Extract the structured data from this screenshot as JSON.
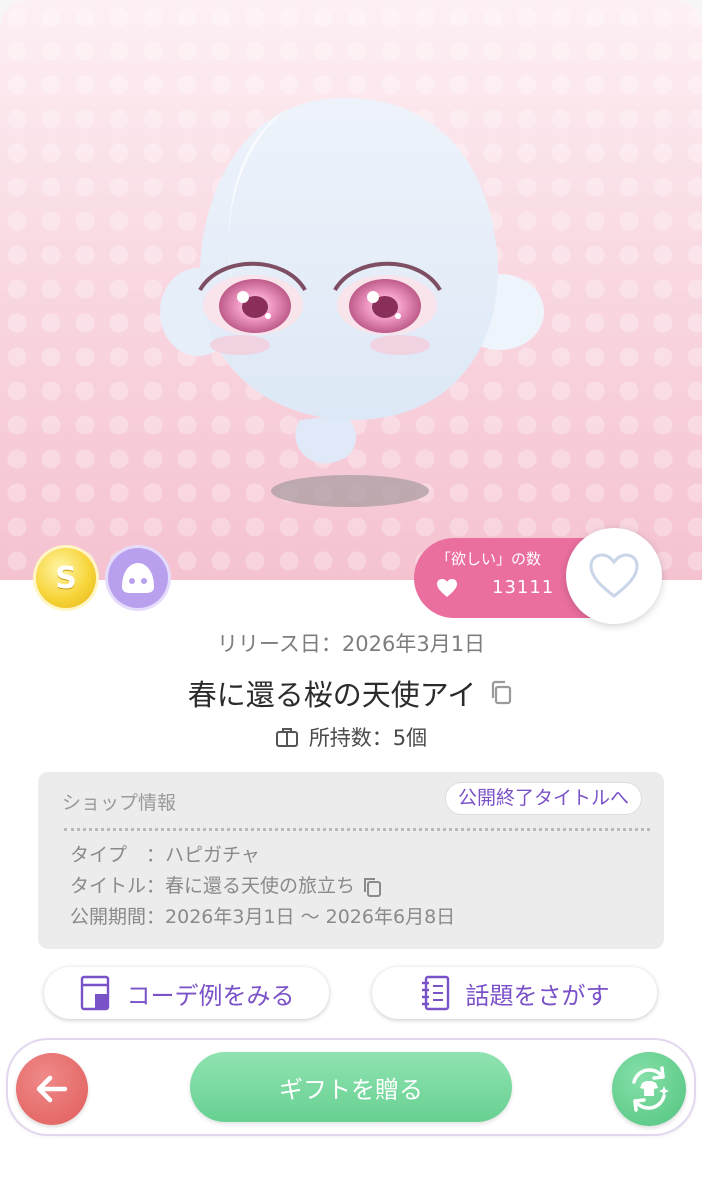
{
  "item": {
    "release_date": "リリース日：2026年3月1日",
    "name": "春に還る桜の天使アイ",
    "owned": "所持数：5個",
    "want_label": "「欲しい」の数",
    "want_count": "13111"
  },
  "badges": [
    {
      "icon": "coin-s-icon",
      "letter": "S"
    },
    {
      "icon": "face-category-icon"
    }
  ],
  "shop_info": {
    "heading": "ショップ情報",
    "ended_link": "公開終了タイトルへ",
    "type_label": "タイプ　：",
    "type_value": "ハピガチャ",
    "title_label": "タイトル：",
    "title_value": "春に還る天使の旅立ち",
    "period_label": "公開期間：",
    "period_value": "2026年3月1日 〜 2026年6月8日"
  },
  "actions": {
    "code_example": "コーデ例をみる",
    "find_topic": "話題をさがす"
  },
  "bottom_bar": {
    "gift": "ギフトを贈る",
    "back_icon": "arrow-left-icon",
    "swap_icon": "shirt-swap-icon"
  },
  "colors": {
    "accent_purple": "#7a52c7",
    "want_pink": "#ea6e9e",
    "gift_green": "#68d092",
    "back_red": "#e05c5b"
  }
}
